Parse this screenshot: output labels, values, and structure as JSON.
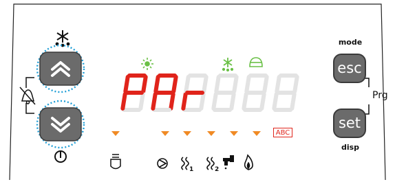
{
  "display": {
    "characters": [
      "P",
      "A",
      "r",
      "",
      "",
      ""
    ],
    "segment_on_color": "#e0241b",
    "segment_off_color": "#e3e3e3",
    "abc_label": "ABC"
  },
  "buttons": {
    "esc_label": "esc",
    "set_label": "set",
    "mode_label": "mode",
    "disp_label": "disp",
    "prg_label": "Prg"
  },
  "colors": {
    "led_green": "#6ac046",
    "led_orange": "#f08a24",
    "button_grey": "#6b6b6b",
    "highlight_blue": "#1f9ed6",
    "segment_red": "#e0241b"
  },
  "icons": {
    "top_indicators": [
      "sun-icon",
      "snowflake-indicator-icon",
      "bell-alarm-icon"
    ],
    "bottom_row": [
      "cylinder-icon",
      "compressor-icon",
      "heater-1-icon",
      "heater-2-icon",
      "tap-icon",
      "flame-icon"
    ],
    "left_side": [
      "snowflake-icon",
      "alarm-mute-icon",
      "power-icon"
    ]
  }
}
